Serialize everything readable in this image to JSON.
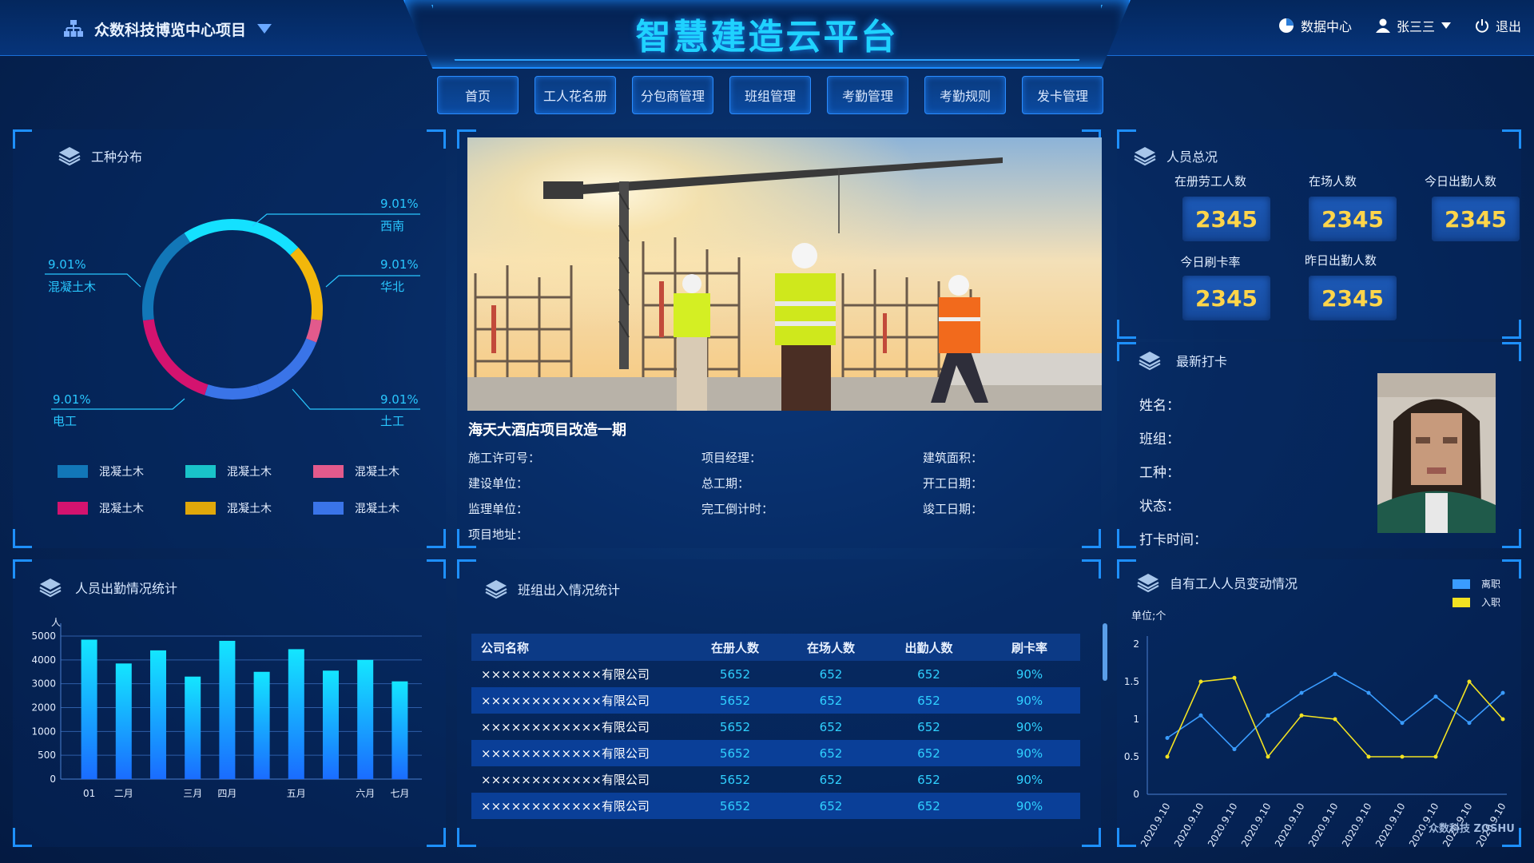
{
  "header": {
    "project": "众数科技博览中心项目",
    "title": "智慧建造云平台",
    "data_center": "数据中心",
    "user": "张三三",
    "logout": "退出"
  },
  "nav": [
    "首页",
    "工人花名册",
    "分包商管理",
    "班组管理",
    "考勤管理",
    "考勤规则",
    "发卡管理"
  ],
  "work_type": {
    "title": "工种分布",
    "callouts": [
      {
        "pct": "9.01%",
        "name": "西南"
      },
      {
        "pct": "9.01%",
        "name": "华北"
      },
      {
        "pct": "9.01%",
        "name": "土工"
      },
      {
        "pct": "9.01%",
        "name": "电工"
      },
      {
        "pct": "9.01%",
        "name": "混凝土木"
      }
    ],
    "legend": [
      {
        "name": "混凝土木",
        "color": "#1277b8"
      },
      {
        "name": "混凝土木",
        "color": "#19c3c9"
      },
      {
        "name": "混凝土木",
        "color": "#e25a8c"
      },
      {
        "name": "混凝土木",
        "color": "#d4136f"
      },
      {
        "name": "混凝土木",
        "color": "#e0a70a"
      },
      {
        "name": "混凝土木",
        "color": "#3a74e8"
      }
    ]
  },
  "project": {
    "name": "海天大酒店项目改造一期",
    "fields": [
      [
        "施工许可号：",
        "项目经理：",
        "建筑面积："
      ],
      [
        "建设单位：",
        "总工期：",
        "开工日期："
      ],
      [
        "监理单位：",
        "完工倒计时：",
        "竣工日期："
      ],
      [
        "项目地址：",
        "",
        ""
      ]
    ]
  },
  "overview": {
    "title": "人员总况",
    "stats": [
      {
        "label": "在册劳工人数",
        "value": "2345"
      },
      {
        "label": "在场人数",
        "value": "2345"
      },
      {
        "label": "今日出勤人数",
        "value": "2345"
      },
      {
        "label": "今日刷卡率",
        "value": "2345"
      },
      {
        "label": "昨日出勤人数",
        "value": "2345"
      }
    ]
  },
  "latest": {
    "title": "最新打卡",
    "fields": [
      "姓名：",
      "班组：",
      "工种：",
      "状态：",
      "打卡时间："
    ]
  },
  "attendance": {
    "title": "人员出勤情况统计"
  },
  "team": {
    "title": "班组出入情况统计",
    "columns": [
      "公司名称",
      "在册人数",
      "在场人数",
      "出勤人数",
      "刷卡率"
    ],
    "rows": [
      [
        "××××××××××××有限公司",
        "5652",
        "652",
        "652",
        "90%"
      ],
      [
        "××××××××××××有限公司",
        "5652",
        "652",
        "652",
        "90%"
      ],
      [
        "××××××××××××有限公司",
        "5652",
        "652",
        "652",
        "90%"
      ],
      [
        "××××××××××××有限公司",
        "5652",
        "652",
        "652",
        "90%"
      ],
      [
        "××××××××××××有限公司",
        "5652",
        "652",
        "652",
        "90%"
      ],
      [
        "××××××××××××有限公司",
        "5652",
        "652",
        "652",
        "90%"
      ]
    ]
  },
  "change": {
    "title": "自有工人人员变动情况",
    "unit": "单位;个"
  },
  "watermark": "众数科技 ZOSHU",
  "colors": {
    "accent": "#1fd2ff",
    "value": "#ffd54a",
    "cyan": "#29c7ff"
  },
  "chart_data": [
    {
      "type": "pie",
      "subtype": "donut",
      "values": [
        22,
        14,
        4,
        14,
        10,
        18,
        18
      ],
      "colors": [
        "#14e1ff",
        "#f2b70b",
        "#e25a8c",
        "#3a74e8",
        "#3a74e8",
        "#d4136f",
        "#1277b8"
      ]
    },
    {
      "type": "bar",
      "ylabel": "人",
      "ylim": [
        0,
        5000
      ],
      "yticks": [
        "0",
        "500",
        "1000",
        "2000",
        "3000",
        "4000",
        "5000"
      ],
      "yticks_values": [
        0,
        1000,
        2000,
        3000,
        4000,
        5000,
        6000
      ],
      "categories": [
        "01",
        "二月",
        "",
        "三月",
        "四月",
        "",
        "五月",
        "",
        "六月",
        "七月"
      ],
      "tick_labels": [
        "01",
        "二月",
        "三月",
        "四月",
        "五月",
        "六月",
        "七月"
      ],
      "values": [
        5850,
        4850,
        5400,
        4300,
        5800,
        4500,
        5450,
        4550,
        5000,
        4100
      ],
      "note": ""
    },
    {
      "type": "line",
      "ylim": [
        0,
        2
      ],
      "yticks": [
        "0",
        "0.5",
        "1",
        "1.5",
        "2"
      ],
      "x": [
        "2020.9.10",
        "2020.9.10",
        "2020.9.10",
        "2020.9.10",
        "2020.9.10",
        "2020.9.10",
        "2020.9.10",
        "2020.9.10",
        "2020.9.10",
        "2020.9.10",
        "2020.9.10"
      ],
      "series": [
        {
          "name": "离职",
          "color": "#3a9cff",
          "values": [
            0.75,
            1.05,
            0.6,
            1.05,
            1.35,
            1.6,
            1.35,
            0.95,
            1.3,
            0.95,
            1.35
          ]
        },
        {
          "name": "入职",
          "color": "#f2e222",
          "values": [
            0.5,
            1.5,
            1.55,
            0.5,
            1.05,
            1.0,
            0.5,
            0.5,
            0.5,
            1.5,
            1.0
          ]
        }
      ],
      "legend": "top-right"
    }
  ]
}
